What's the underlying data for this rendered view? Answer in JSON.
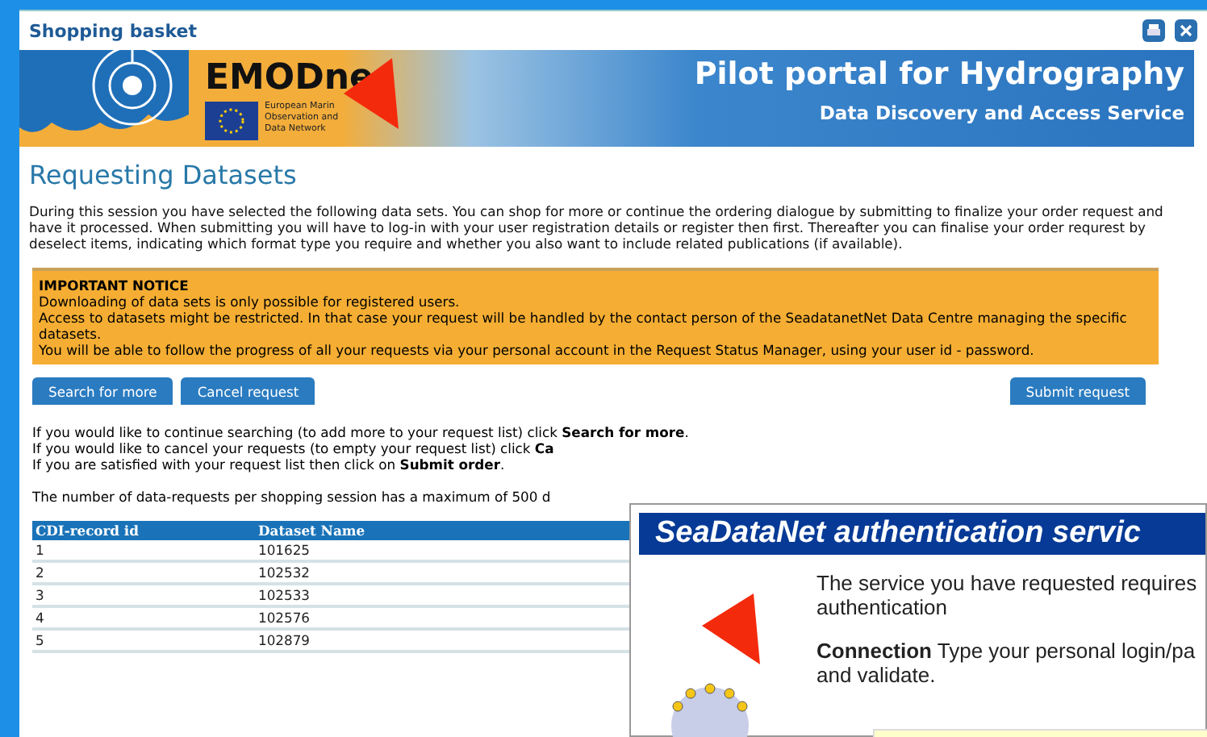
{
  "window": {
    "title": "Shopping basket"
  },
  "banner": {
    "logo_text": "EMODne",
    "logo_subtitle": [
      "European Marin",
      "Observation and",
      "Data Network"
    ],
    "title": "Pilot portal for Hydrography",
    "subtitle": "Data Discovery and Access Service"
  },
  "heading": "Requesting Datasets",
  "intro": "During this session you have selected the following data sets. You can shop for more or continue the ordering dialogue by submitting to finalize your order request and have it processed. When submitting you will have to log-in with your user registration details or register then first. Thereafter you can finalise your order requrest by deselect items, indicating which format type you require and whether you also want to include related publications (if available).",
  "notice": {
    "title": "IMPORTANT NOTICE",
    "lines": [
      "Downloading of data sets is only possible for registered users.",
      "Access to datasets might be restricted. In that case your request will be handled by the contact person of the SeadatanetNet Data Centre managing the specific datasets.",
      "You will be able to follow the progress of all your requests via your personal account in the Request Status Manager, using your user id - password."
    ]
  },
  "buttons": [
    "Search for more",
    "Cancel request"
  ],
  "submit_button": "Submit request",
  "instructions": [
    "If you would like to continue searching (to add more to your request list) click **Search for more**.",
    "If you would like to cancel your requests (to empty your request list) click **Ca**",
    "If you are satisfied with your request list then click on **Submit order**."
  ],
  "limit_note": "The number of data-requests per shopping session has a maximum of 500 d",
  "table": {
    "columns": [
      "CDI-record id",
      "Dataset Name"
    ],
    "rows": [
      [
        "1",
        "101625"
      ],
      [
        "2",
        "102532"
      ],
      [
        "3",
        "102533"
      ],
      [
        "4",
        "102576"
      ],
      [
        "5",
        "102879"
      ]
    ]
  },
  "popup": {
    "title": "SeaDataNet authentication servic",
    "paragraphs": [
      "The service you have requested requires authentication",
      "**Connection** Type your personal login/pa and validate."
    ]
  }
}
